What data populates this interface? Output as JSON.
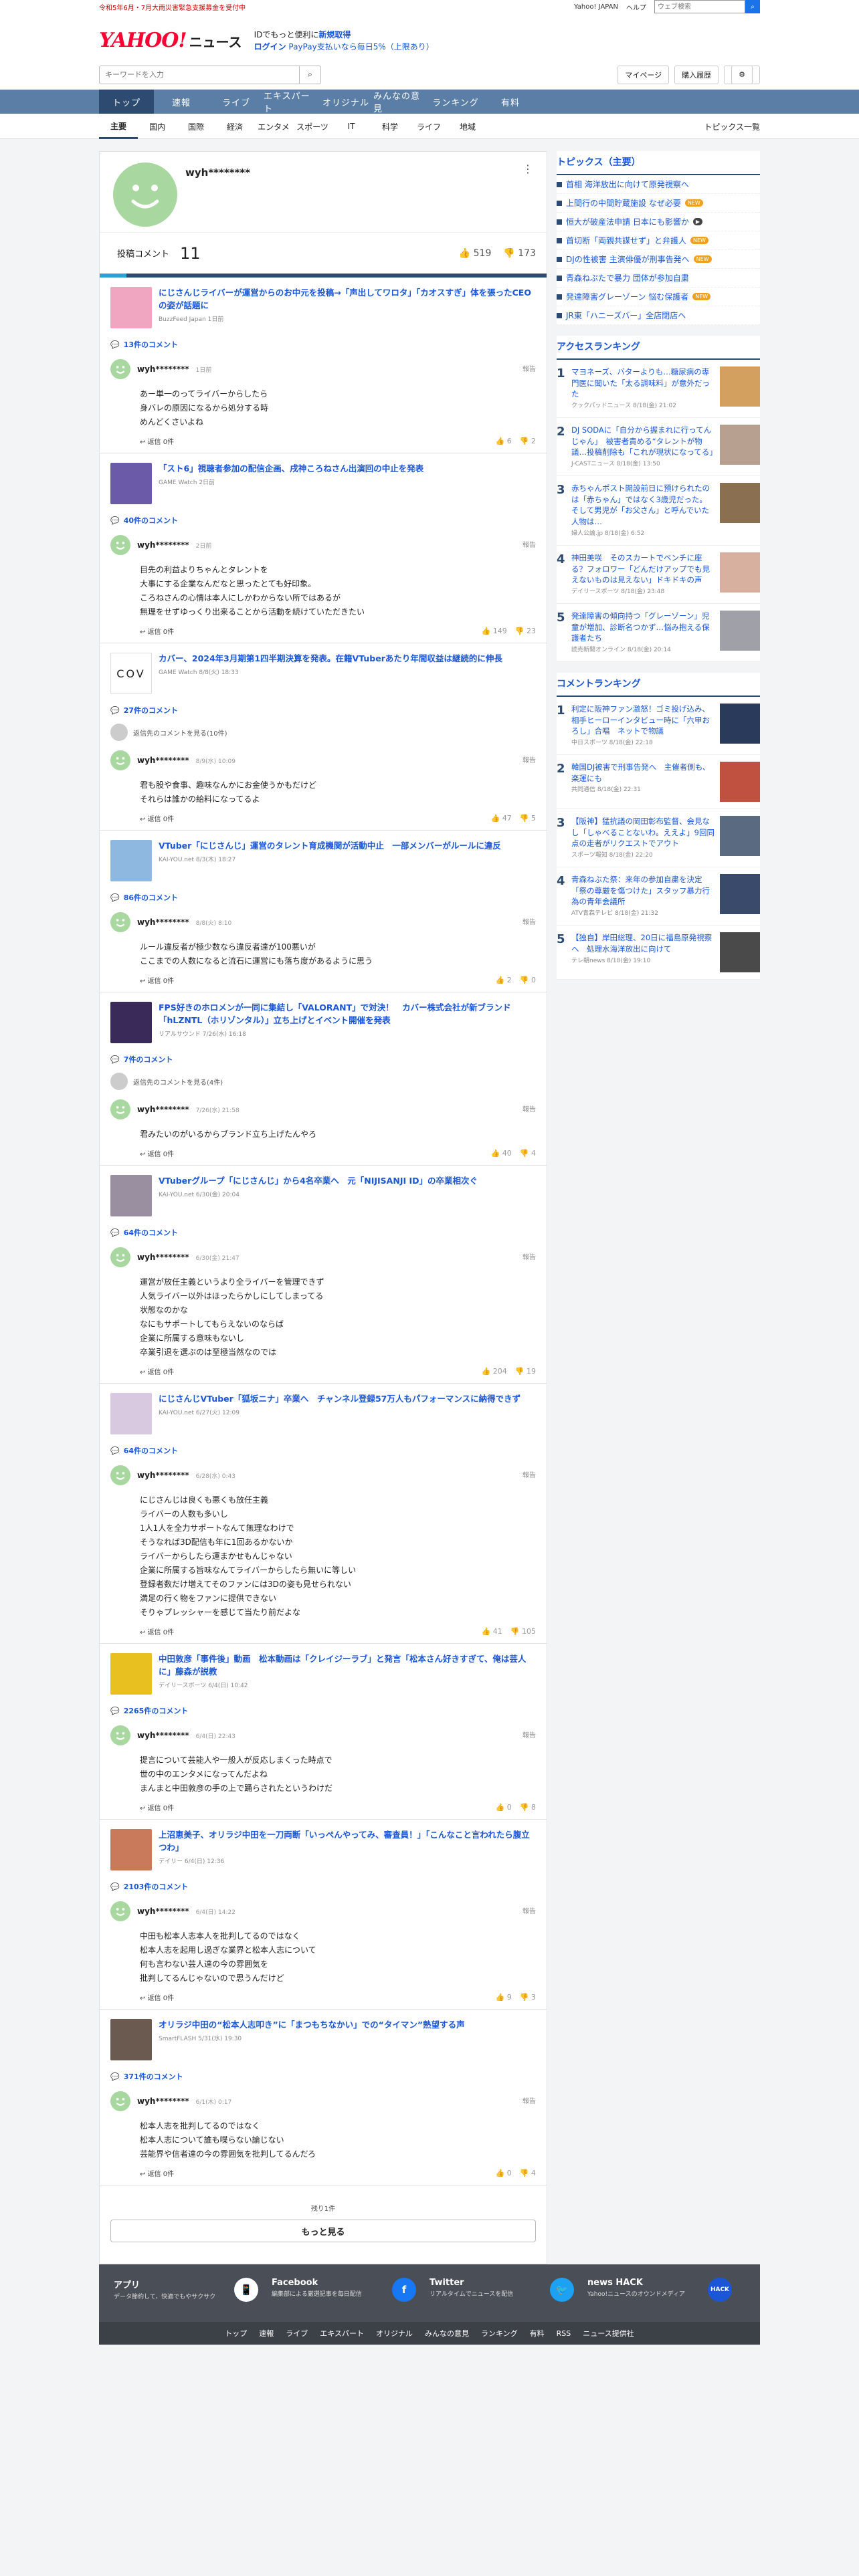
{
  "top": {
    "alert": "令和5年6月・7月大雨災害緊急支援募金を受付中",
    "links": [
      "Yahoo! JAPAN",
      "ヘルプ"
    ],
    "search_placeholder": "ウェブ検索"
  },
  "brand": {
    "logo": "YAHOO!",
    "logo_sub": "JAPAN",
    "news": "ニュース",
    "promo_line1_a": "IDでもっと便利に",
    "promo_line1_b": "新規取得",
    "promo_line2_a": "ログイン",
    "promo_line2_b": "PayPay支払いなら毎日5%（上限あり）"
  },
  "search": {
    "placeholder": "キーワードを入力",
    "mypage": "マイページ",
    "history": "購入履歴"
  },
  "gnav": [
    "トップ",
    "速報",
    "ライブ",
    "エキスパート",
    "オリジナル",
    "みんなの意見",
    "ランキング",
    "有料"
  ],
  "snav": [
    "主要",
    "国内",
    "国際",
    "経済",
    "エンタメ",
    "スポーツ",
    "IT",
    "科学",
    "ライフ",
    "地域"
  ],
  "snav_all": "トピックス一覧",
  "profile": {
    "name": "wyh********",
    "posts_label": "投稿コメント",
    "posts_count": "11",
    "likes": "519",
    "dislikes": "173"
  },
  "items": [
    {
      "thumb": "#f0a5c0",
      "headline": "にじさんじライバーが運営からのお中元を投稿→「声出してワロタ」「カオスすぎ」体を張ったCEOの姿が話題に",
      "source": "BuzzFeed Japan 1日前",
      "count": "13件のコメント",
      "more": "",
      "user": "wyh********",
      "time": "1日前",
      "report": "報告",
      "body": "あー単一のってライバーからしたら\n身バレの原因になるから処分する時\nめんどくさいよね",
      "reply": "返信 0件",
      "likes": "6",
      "dislikes": "2"
    },
    {
      "thumb": "#6a5aa8",
      "headline": "「スト6」視聴者参加の配信企画、戌神ころねさん出演回の中止を発表",
      "source": "GAME Watch 2日前",
      "count": "40件のコメント",
      "more": "",
      "user": "wyh********",
      "time": "2日前",
      "report": "報告",
      "body": "目先の利益よりちゃんとタレントを\n大事にする企業なんだなと思ったとても好印象。\nころねさんの心情は本人にしかわからない所ではあるが\n無理をせずゆっくり出来ることから活動を続けていただきたい",
      "reply": "返信 0件",
      "likes": "149",
      "dislikes": "23"
    },
    {
      "thumb": "#ffffff",
      "headline": "カバー、2024年3月期第1四半期決算を発表。在籍VTuberあたり年間収益は継続的に伸長",
      "source": "GAME Watch 8/8(火) 18:33",
      "count": "27件のコメント",
      "more": "返信先のコメントを見る(10件)",
      "user": "wyh********",
      "time": "8/9(水) 10:09",
      "report": "報告",
      "body": "君も股や食事、趣味なんかにお金使うかもだけど\nそれらは誰かの給料になってるよ",
      "reply": "返信 0件",
      "likes": "47",
      "dislikes": "5"
    },
    {
      "thumb": "#8fb8e0",
      "headline": "VTuber「にじさんじ」運営のタレント育成機関が活動中止　一部メンバーがルールに違反",
      "source": "KAI-YOU.net 8/3(木) 18:27",
      "count": "86件のコメント",
      "more": "",
      "user": "wyh********",
      "time": "8/8(火) 8:10",
      "report": "報告",
      "body": "ルール違反者が極少数なら違反者達が100悪いが\nここまでの人数になると流石に運営にも落ち度があるように思う",
      "reply": "返信 0件",
      "likes": "2",
      "dislikes": "0"
    },
    {
      "thumb": "#3a2a5a",
      "headline": "FPS好きのホロメンが一同に集結し「VALORANT」で対決！　カバー株式会社が新ブランド「hLZNTL（ホリゾンタル）」立ち上げとイベント開催を発表",
      "source": "リアルサウンド 7/26(水) 16:18",
      "count": "7件のコメント",
      "more": "返信先のコメントを見る(4件)",
      "user": "wyh********",
      "time": "7/26(水) 21:58",
      "report": "報告",
      "body": "君みたいのがいるからブランド立ち上げたんやろ",
      "reply": "返信 0件",
      "likes": "40",
      "dislikes": "4"
    },
    {
      "thumb": "#9a8fa0",
      "headline": "VTuberグループ「にじさんじ」から4名卒業へ　元「NIJISANJI ID」の卒業相次ぐ",
      "source": "KAI-YOU.net 6/30(金) 20:04",
      "count": "64件のコメント",
      "more": "",
      "user": "wyh********",
      "time": "6/30(金) 21:47",
      "report": "報告",
      "body": "運営が放任主義というより全ライバーを管理できず\n人気ライバー以外はほったらかしにしてしまってる\n状態なのかな\nなにもサポートしてもらえないのならば\n企業に所属する意味もないし\n卒業引退を選ぶのは至極当然なのでは",
      "reply": "返信 0件",
      "likes": "204",
      "dislikes": "19"
    },
    {
      "thumb": "#d8c8e0",
      "headline": "にじさんじVTuber「狐坂ニナ」卒業へ　チャンネル登録57万人もパフォーマンスに納得できず",
      "source": "KAI-YOU.net 6/27(火) 12:09",
      "count": "64件のコメント",
      "more": "",
      "user": "wyh********",
      "time": "6/28(水) 0:43",
      "report": "報告",
      "body": "にじさんじは良くも悪くも放任主義\nライバーの人数も多いし\n1人1人を全力サポートなんて無理なわけで\nそうなれば3D配信も年に1回あるかないか\nライバーからしたら運まかせもんじゃない\n企業に所属する旨味なんてライバーからしたら無いに等しい\n登録者数だけ増えてそのファンには3Dの姿も見せられない\n満足の行く物をファンに提供できない\nそりゃプレッシャーを感じて当たり前だよな",
      "reply": "返信 0件",
      "likes": "41",
      "dislikes": "105"
    },
    {
      "thumb": "#e8c020",
      "headline": "中田敦彦「事件後」動画　松本動画は「クレイジーラブ」と発言「松本さん好きすぎて、俺は芸人に」藤森が説教",
      "source": "デイリースポーツ 6/4(日) 10:42",
      "count": "2265件のコメント",
      "more": "",
      "user": "wyh********",
      "time": "6/4(日) 22:43",
      "report": "報告",
      "body": "提言について芸能人や一般人が反応しまくった時点で\n世の中のエンタメになってんだよね\nまんまと中田敦彦の手の上で踊らされたというわけだ",
      "reply": "返信 0件",
      "likes": "0",
      "dislikes": "8"
    },
    {
      "thumb": "#c87a5a",
      "headline": "上沼恵美子、オリラジ中田を一刀両断「いっぺんやってみ、審査員！」「こんなこと言われたら腹立つわ」",
      "source": "デイリー 6/4(日) 12:36",
      "count": "2103件のコメント",
      "more": "",
      "user": "wyh********",
      "time": "6/4(日) 14:22",
      "report": "報告",
      "body": "中田も松本人志本人を批判してるのではなく\n松本人志を起用し過ぎな業界と松本人志について\n何も言わない芸人達の今の雰囲気を\n批判してるんじゃないので思うんだけど",
      "reply": "返信 0件",
      "likes": "9",
      "dislikes": "3"
    },
    {
      "thumb": "#6a5a50",
      "headline": "オリラジ中田の“松本人志叩き”に「まつもちなかい」での“タイマン”熱望する声",
      "source": "SmartFLASH 5/31(水) 19:30",
      "count": "371件のコメント",
      "more": "",
      "user": "wyh********",
      "time": "6/1(木) 0:17",
      "report": "報告",
      "body": "松本人志を批判してるのではなく\n松本人志について誰も喋らない論じない\n芸能界や信者達の今の雰囲気を批判してるんだろ",
      "reply": "返信 0件",
      "likes": "0",
      "dislikes": "4"
    }
  ],
  "remaining": "残り1件",
  "more_button": "もっと見る",
  "topics": {
    "title": "トピックス（主要）",
    "items": [
      {
        "t": "首相 海洋放出に向けて原発視察へ",
        "badge": ""
      },
      {
        "t": "上間行の中間貯蔵施設 なぜ必要",
        "badge": "NEW"
      },
      {
        "t": "恒大が破産法申請 日本にも影響か",
        "badge": "▶"
      },
      {
        "t": "首切断「両親共謀せず」と弁護人",
        "badge": "NEW"
      },
      {
        "t": "DJの性被害 主演俳優が刑事告発へ",
        "badge": "NEW"
      },
      {
        "t": "青森ねぶたで暴力 団体が参加自粛",
        "badge": ""
      },
      {
        "t": "発達障害グレーゾーン 悩む保護者",
        "badge": "NEW"
      },
      {
        "t": "JR東「ハニーズバー」全店閉店へ",
        "badge": ""
      }
    ]
  },
  "access_ranking": {
    "title": "アクセスランキング",
    "items": [
      {
        "n": "1",
        "t": "マヨネーズ、バターよりも…糖尿病の専門医に聞いた「太る調味料」が意外だった",
        "s": "クックパッドニュース 8/18(金) 21:02",
        "c": "#d4a060"
      },
      {
        "n": "2",
        "t": "DJ SODAに「自分から握まれに行ってんじゃん」　被害者責める“タレントが物議…投稿削除も「これが現状になってる」",
        "s": "J-CASTニュース 8/18(金) 13:50",
        "c": "#b8a090"
      },
      {
        "n": "3",
        "t": "赤ちゃんポスト開設前日に預けられたのは「赤ちゃん」ではなく3歳児だった。そして男児が「お父さん」と呼んでいた人物は…",
        "s": "婦人公論.jp 8/18(金) 6:52",
        "c": "#8a7050"
      },
      {
        "n": "4",
        "t": "神田美咲　そのスカートでベンチに座る？フォロワー「どんだけアップでも見えないものは見えない」ドキドキの声",
        "s": "デイリースポーツ 8/18(金) 23:48",
        "c": "#d8b0a0"
      },
      {
        "n": "5",
        "t": "発達障害の傾向持つ「グレーゾーン」児童が増加、診断名つかず…悩み抱える保護者たち",
        "s": "読売新聞オンライン 8/18(金) 20:14",
        "c": "#a0a0a8"
      }
    ]
  },
  "comment_ranking": {
    "title": "コメントランキング",
    "items": [
      {
        "n": "1",
        "t": "利定に阪神ファン激怒！ゴミ投げ込み、相手ヒーローインタビュー時に「六甲おろし」合唱　ネットで物議",
        "s": "中日スポーツ 8/18(金) 22:18",
        "c": "#2a3a5a"
      },
      {
        "n": "2",
        "t": "韓国DJ被害で刑事告発へ　主催者側も、楽運にも",
        "s": "共同通信 8/18(金) 22:31",
        "c": "#c05040"
      },
      {
        "n": "3",
        "t": "【阪神】猛抗議の岡田彰布監督、会見なし「しゃべることないわ。ええよ」9回同点の走者がリクエストでアウト",
        "s": "スポーツ報知 8/18(金) 22:20",
        "c": "#5a6a80"
      },
      {
        "n": "4",
        "t": "青森ねぶた祭：来年の参加自粛を決定「祭の尊厳を傷つけた」スタッフ暴力行為の青年会議所",
        "s": "ATV青森テレビ 8/18(金) 21:32",
        "c": "#3a4a6a"
      },
      {
        "n": "5",
        "t": "【独自】岸田総理、20日に福島原発視察へ　処理水海洋放出に向けて",
        "s": "テレ朝news 8/18(金) 19:10",
        "c": "#4a4a4a"
      }
    ]
  },
  "footer": {
    "cols": [
      {
        "t": "アプリ",
        "d": "データ節約して、快適でもやサクサク",
        "ic": "📱",
        "c": "#ffffff"
      },
      {
        "t": "Facebook",
        "d": "編集部による厳選記事を毎日配信",
        "ic": "f",
        "c": "#1877f2"
      },
      {
        "t": "Twitter",
        "d": "リアルタイムでニュースを配信",
        "ic": "🐦",
        "c": "#1da1f2"
      },
      {
        "t": "news HACK",
        "d": "Yahoo!ニュースのオウンドメディア",
        "ic": "HACK",
        "c": "#1a56d6"
      }
    ],
    "nav": [
      "トップ",
      "速報",
      "ライブ",
      "エキスパート",
      "オリジナル",
      "みんなの意見",
      "ランキング",
      "有料",
      "RSS",
      "ニュース提供社"
    ]
  },
  "colors": {
    "accent": "#1a56d6",
    "nav": "#2d4b70",
    "brand_red": "#ff0033"
  }
}
